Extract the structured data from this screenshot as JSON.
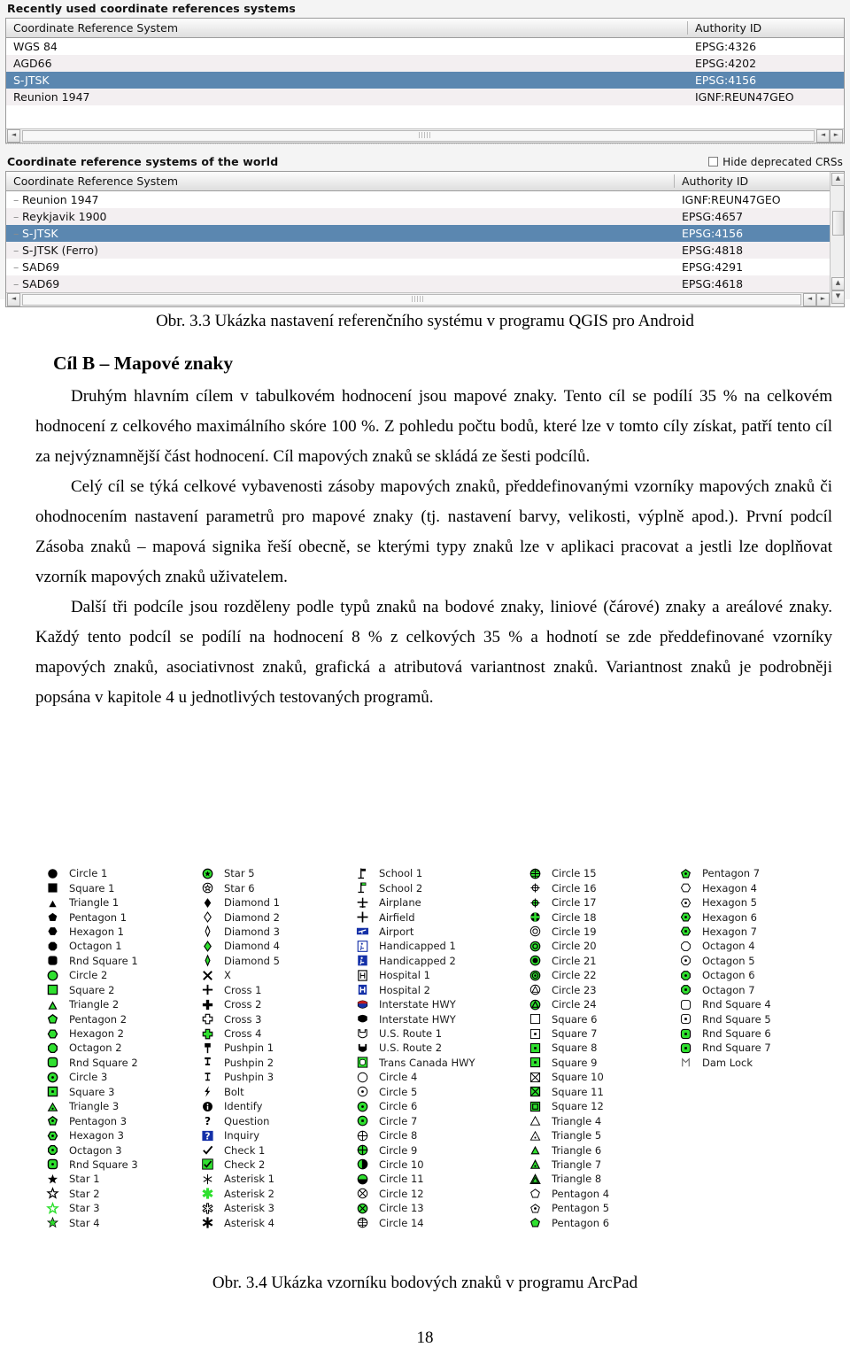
{
  "crs_dialog": {
    "recent_section": {
      "title": "Recently used coordinate references systems",
      "columns": [
        "Coordinate Reference System",
        "Authority ID"
      ],
      "rows": [
        {
          "name": "WGS 84",
          "authority": "EPSG:4326",
          "selected": false
        },
        {
          "name": "AGD66",
          "authority": "EPSG:4202",
          "selected": false
        },
        {
          "name": "S-JTSK",
          "authority": "EPSG:4156",
          "selected": true
        },
        {
          "name": "Reunion 1947",
          "authority": "IGNF:REUN47GEO",
          "selected": false
        }
      ]
    },
    "world_section": {
      "title": "Coordinate reference systems of the world",
      "hide_deprecated_label": "Hide deprecated CRSs",
      "hide_deprecated_checked": false,
      "columns": [
        "Coordinate Reference System",
        "Authority ID"
      ],
      "rows": [
        {
          "name": "Reunion 1947",
          "authority": "IGNF:REUN47GEO",
          "selected": false
        },
        {
          "name": "Reykjavik 1900",
          "authority": "EPSG:4657",
          "selected": false
        },
        {
          "name": "S-JTSK",
          "authority": "EPSG:4156",
          "selected": true
        },
        {
          "name": "S-JTSK (Ferro)",
          "authority": "EPSG:4818",
          "selected": false
        },
        {
          "name": "SAD69",
          "authority": "EPSG:4291",
          "selected": false
        },
        {
          "name": "SAD69",
          "authority": "EPSG:4618",
          "selected": false
        }
      ]
    },
    "selection_color": "#5b87b0"
  },
  "document": {
    "figure_caption_33": "Obr. 3.3 Ukázka nastavení referenčního systému v programu QGIS pro Android",
    "heading": "Cíl B – Mapové znaky",
    "paragraphs": [
      "Druhým hlavním cílem v tabulkovém hodnocení jsou mapové znaky. Tento cíl se podílí 35 % na celkovém hodnocení z celkového maximálního skóre 100 %. Z pohledu počtu bodů, které lze v tomto cíly získat, patří tento cíl za nejvýznamnější část hodnocení. Cíl mapových znaků se skládá ze šesti podcílů.",
      "Celý cíl se týká celkové vybavenosti zásoby mapových znaků, předdefinovanými vzorníky mapových znaků či ohodnocením nastavení parametrů pro mapové znaky (tj. nastavení barvy, velikosti, výplně apod.). První podcíl Zásoba znaků – mapová signika řeší obecně, se kterými typy znaků lze v aplikaci pracovat a jestli lze doplňovat vzorník mapových znaků uživatelem.",
      "Další tři podcíle jsou rozděleny podle typů znaků na bodové znaky, liniové (čárové) znaky a areálové znaky. Každý tento podcíl se podílí na hodnocení 8 % z celkových 35 % a hodnotí se zde předdefinované vzorníky mapových znaků, asociativnost znaků, grafická a atributová variantnost znaků. Variantnost znaků je podrobněji popsána v kapitole 4 u jednotlivých testovaných programů."
    ],
    "figure_caption_34": "Obr. 3.4 Ukázka vzorníku bodových znaků v programu ArcPad",
    "page_number": "18"
  },
  "symbol_palette": {
    "accent_green": "#2fe02f",
    "accent_blue": "#1430a8",
    "columns": [
      {
        "items": [
          {
            "label": "Circle 1",
            "icon": "circle-filled-black"
          },
          {
            "label": "Square 1",
            "icon": "square-filled-black"
          },
          {
            "label": "Triangle 1",
            "icon": "triangle-filled-black"
          },
          {
            "label": "Pentagon 1",
            "icon": "pentagon-filled-black"
          },
          {
            "label": "Hexagon 1",
            "icon": "hexagon-filled-black"
          },
          {
            "label": "Octagon 1",
            "icon": "octagon-filled-black"
          },
          {
            "label": "Rnd Square 1",
            "icon": "rounded-square-filled-black"
          },
          {
            "label": "Circle 2",
            "icon": "circle-filled-green"
          },
          {
            "label": "Square 2",
            "icon": "square-filled-green"
          },
          {
            "label": "Triangle 2",
            "icon": "triangle-filled-green"
          },
          {
            "label": "Pentagon 2",
            "icon": "pentagon-filled-green"
          },
          {
            "label": "Hexagon 2",
            "icon": "hexagon-filled-green"
          },
          {
            "label": "Octagon 2",
            "icon": "octagon-filled-green"
          },
          {
            "label": "Rnd Square 2",
            "icon": "rounded-square-filled-green"
          },
          {
            "label": "Circle 3",
            "icon": "circle-green-dot"
          },
          {
            "label": "Square 3",
            "icon": "square-green-dot"
          },
          {
            "label": "Triangle 3",
            "icon": "triangle-green-dot"
          },
          {
            "label": "Pentagon 3",
            "icon": "pentagon-green-dot"
          },
          {
            "label": "Hexagon 3",
            "icon": "hexagon-green-dot"
          },
          {
            "label": "Octagon 3",
            "icon": "octagon-green-dot"
          },
          {
            "label": "Rnd Square 3",
            "icon": "rounded-square-green-dot"
          },
          {
            "label": "Star 1",
            "icon": "star-filled-black"
          },
          {
            "label": "Star 2",
            "icon": "star-outline-black"
          },
          {
            "label": "Star 3",
            "icon": "star-outline-green"
          },
          {
            "label": "Star 4",
            "icon": "star-filled-green"
          }
        ]
      },
      {
        "items": [
          {
            "label": "Star 5",
            "icon": "star-in-circle-green"
          },
          {
            "label": "Star 6",
            "icon": "star-in-circle-outline"
          },
          {
            "label": "Diamond 1",
            "icon": "diamond-filled-black"
          },
          {
            "label": "Diamond 2",
            "icon": "diamond-outline-black"
          },
          {
            "label": "Diamond 3",
            "icon": "diamond-narrow-outline"
          },
          {
            "label": "Diamond 4",
            "icon": "diamond-filled-green"
          },
          {
            "label": "Diamond 5",
            "icon": "diamond-narrow-green"
          },
          {
            "label": "X",
            "icon": "x-mark-black"
          },
          {
            "label": "Cross 1",
            "icon": "cross-thin-black"
          },
          {
            "label": "Cross 2",
            "icon": "cross-thick-black"
          },
          {
            "label": "Cross 3",
            "icon": "cross-outline-black"
          },
          {
            "label": "Cross 4",
            "icon": "cross-filled-green"
          },
          {
            "label": "Pushpin 1",
            "icon": "pushpin-filled-black"
          },
          {
            "label": "Pushpin 2",
            "icon": "pushpin-outline-black"
          },
          {
            "label": "Pushpin 3",
            "icon": "pushpin-thin-black"
          },
          {
            "label": "Bolt",
            "icon": "lightning-bolt-black"
          },
          {
            "label": "Identify",
            "icon": "info-circle-black"
          },
          {
            "label": "Question",
            "icon": "question-mark-black"
          },
          {
            "label": "Inquiry",
            "icon": "question-box-blue"
          },
          {
            "label": "Check 1",
            "icon": "check-mark-black"
          },
          {
            "label": "Check 2",
            "icon": "check-box-green"
          },
          {
            "label": "Asterisk 1",
            "icon": "asterisk-thin-black"
          },
          {
            "label": "Asterisk 2",
            "icon": "asterisk-filled-green"
          },
          {
            "label": "Asterisk 3",
            "icon": "asterisk-outline-black"
          },
          {
            "label": "Asterisk 4",
            "icon": "asterisk-thick-black"
          }
        ]
      },
      {
        "items": [
          {
            "label": "School 1",
            "icon": "school-flag-black"
          },
          {
            "label": "School 2",
            "icon": "school-flag-green"
          },
          {
            "label": "Airplane",
            "icon": "airplane-black"
          },
          {
            "label": "Airfield",
            "icon": "airfield-cross-black"
          },
          {
            "label": "Airport",
            "icon": "airport-blue-box"
          },
          {
            "label": "Handicapped 1",
            "icon": "handicapped-outline-blue"
          },
          {
            "label": "Handicapped 2",
            "icon": "handicapped-filled-blue"
          },
          {
            "label": "Hospital 1",
            "icon": "hospital-h-outline"
          },
          {
            "label": "Hospital 2",
            "icon": "hospital-h-filled-blue"
          },
          {
            "label": "Interstate HWY",
            "icon": "interstate-shield-color"
          },
          {
            "label": "Interstate HWY",
            "icon": "interstate-shield-black"
          },
          {
            "label": "U.S. Route 1",
            "icon": "us-route-outline"
          },
          {
            "label": "U.S. Route 2",
            "icon": "us-route-filled-black"
          },
          {
            "label": "Trans Canada HWY",
            "icon": "trans-canada-green"
          },
          {
            "label": "Circle 4",
            "icon": "circle-outline-thin"
          },
          {
            "label": "Circle 5",
            "icon": "circle-outline-dot"
          },
          {
            "label": "Circle 6",
            "icon": "circle-green-small-dot"
          },
          {
            "label": "Circle 7",
            "icon": "circle-green-black-dot"
          },
          {
            "label": "Circle 8",
            "icon": "circle-crosshair-outline"
          },
          {
            "label": "Circle 9",
            "icon": "circle-crosshair-green"
          },
          {
            "label": "Circle 10",
            "icon": "circle-half-vertical-green"
          },
          {
            "label": "Circle 11",
            "icon": "circle-half-filled-green"
          },
          {
            "label": "Circle 12",
            "icon": "circle-x-outline"
          },
          {
            "label": "Circle 13",
            "icon": "circle-x-green"
          },
          {
            "label": "Circle 14",
            "icon": "circle-grid-outline"
          }
        ]
      },
      {
        "items": [
          {
            "label": "Circle 15",
            "icon": "circle-grid-green"
          },
          {
            "label": "Circle 16",
            "icon": "circle-target-outline"
          },
          {
            "label": "Circle 17",
            "icon": "circle-target-green"
          },
          {
            "label": "Circle 18",
            "icon": "circle-cross-filled-green"
          },
          {
            "label": "Circle 19",
            "icon": "circle-ring-outline"
          },
          {
            "label": "Circle 20",
            "icon": "circle-ring-green"
          },
          {
            "label": "Circle 21",
            "icon": "circle-green-black-center"
          },
          {
            "label": "Circle 22",
            "icon": "circle-double-ring-green"
          },
          {
            "label": "Circle 23",
            "icon": "circle-triangle-outline"
          },
          {
            "label": "Circle 24",
            "icon": "circle-triangle-green"
          },
          {
            "label": "Square 6",
            "icon": "square-outline-thin"
          },
          {
            "label": "Square 7",
            "icon": "square-outline-dot"
          },
          {
            "label": "Square 8",
            "icon": "square-green-black-dot"
          },
          {
            "label": "Square 9",
            "icon": "square-green-dot-small"
          },
          {
            "label": "Square 10",
            "icon": "square-x-outline"
          },
          {
            "label": "Square 11",
            "icon": "square-x-green"
          },
          {
            "label": "Square 12",
            "icon": "square-double-green"
          },
          {
            "label": "Triangle 4",
            "icon": "triangle-outline-thin"
          },
          {
            "label": "Triangle 5",
            "icon": "triangle-outline-dot"
          },
          {
            "label": "Triangle 6",
            "icon": "triangle-green-small"
          },
          {
            "label": "Triangle 7",
            "icon": "triangle-green-dot-2"
          },
          {
            "label": "Triangle 8",
            "icon": "triangle-green-large"
          },
          {
            "label": "Pentagon 4",
            "icon": "pentagon-outline-thin"
          },
          {
            "label": "Pentagon 5",
            "icon": "pentagon-outline-dot"
          },
          {
            "label": "Pentagon 6",
            "icon": "pentagon-green-small"
          }
        ]
      },
      {
        "items": [
          {
            "label": "Pentagon 7",
            "icon": "pentagon-green-dot-2"
          },
          {
            "label": "Hexagon 4",
            "icon": "hexagon-outline-thin"
          },
          {
            "label": "Hexagon 5",
            "icon": "hexagon-outline-dot"
          },
          {
            "label": "Hexagon 6",
            "icon": "hexagon-green-dot-2"
          },
          {
            "label": "Hexagon 7",
            "icon": "hexagon-green-dot-3"
          },
          {
            "label": "Octagon 4",
            "icon": "octagon-outline-thin"
          },
          {
            "label": "Octagon 5",
            "icon": "octagon-outline-dot"
          },
          {
            "label": "Octagon 6",
            "icon": "octagon-green-dot-2"
          },
          {
            "label": "Octagon 7",
            "icon": "octagon-green-dot-3"
          },
          {
            "label": "Rnd Square 4",
            "icon": "rounded-square-outline-thin"
          },
          {
            "label": "Rnd Square 5",
            "icon": "rounded-square-outline-dot"
          },
          {
            "label": "Rnd Square 6",
            "icon": "rounded-square-green-dot-2"
          },
          {
            "label": "Rnd Square 7",
            "icon": "rounded-square-green-dot-3"
          },
          {
            "label": "Dam Lock",
            "icon": "dam-lock-outline"
          }
        ]
      }
    ]
  }
}
